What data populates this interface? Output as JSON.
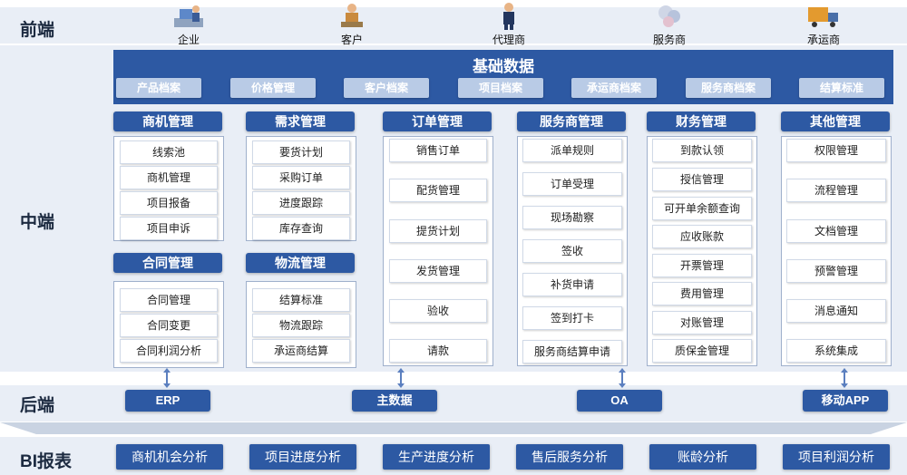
{
  "layers": {
    "front": "前端",
    "middle": "中端",
    "back": "后端",
    "bi": "BI报表"
  },
  "actors": [
    {
      "label": "企业",
      "icon": "enterprise-icon"
    },
    {
      "label": "客户",
      "icon": "customer-icon"
    },
    {
      "label": "代理商",
      "icon": "agent-icon"
    },
    {
      "label": "服务商",
      "icon": "service-provider-icon"
    },
    {
      "label": "承运商",
      "icon": "carrier-truck-icon"
    }
  ],
  "basic_data": {
    "title": "基础数据",
    "items": [
      "产品档案",
      "价格管理",
      "客户档案",
      "项目档案",
      "承运商档案",
      "服务商档案",
      "结算标准"
    ]
  },
  "modules": [
    {
      "title": "商机管理",
      "items": [
        "线索池",
        "商机管理",
        "项目报备",
        "项目申诉"
      ]
    },
    {
      "title": "需求管理",
      "items": [
        "要货计划",
        "采购订单",
        "进度跟踪",
        "库存查询"
      ]
    },
    {
      "title": "订单管理",
      "items": [
        "销售订单",
        "配货管理",
        "提货计划",
        "发货管理",
        "验收",
        "请款"
      ]
    },
    {
      "title": "服务商管理",
      "items": [
        "派单规则",
        "订单受理",
        "现场勘察",
        "签收",
        "补货申请",
        "签到打卡",
        "服务商结算申请"
      ]
    },
    {
      "title": "财务管理",
      "items": [
        "到款认领",
        "授信管理",
        "可开单余额查询",
        "应收账款",
        "开票管理",
        "费用管理",
        "对账管理",
        "质保金管理"
      ]
    },
    {
      "title": "其他管理",
      "items": [
        "权限管理",
        "流程管理",
        "文档管理",
        "预警管理",
        "消息通知",
        "系统集成"
      ]
    },
    {
      "title": "合同管理",
      "items": [
        "合同管理",
        "合同变更",
        "合同利润分析"
      ]
    },
    {
      "title": "物流管理",
      "items": [
        "结算标准",
        "物流跟踪",
        "承运商结算"
      ]
    }
  ],
  "backend": [
    "ERP",
    "主数据",
    "OA",
    "移动APP"
  ],
  "bi_reports": [
    "商机机会分析",
    "项目进度分析",
    "生产进度分析",
    "售后服务分析",
    "账龄分析",
    "项目利润分析"
  ]
}
